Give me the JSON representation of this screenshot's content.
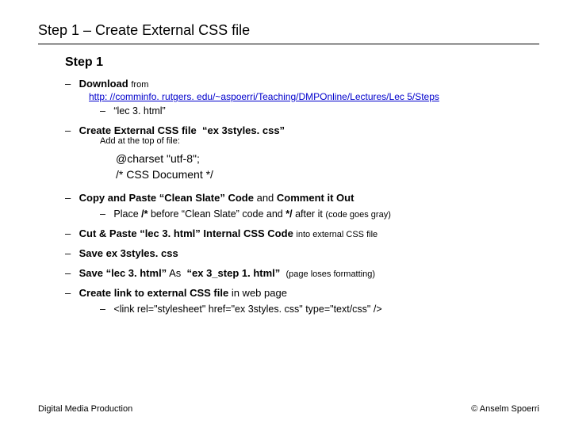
{
  "title": "Step 1 – Create External CSS file",
  "subtitle": "Step 1",
  "items": {
    "download": {
      "label": "Download",
      "suffix": "from"
    },
    "url": "http: //comminfo. rutgers. edu/~aspoerri/Teaching/DMPOnline/Lectures/Lec 5/Steps",
    "lec3": "“lec 3. html”",
    "createcss": {
      "label": "Create External CSS file",
      "arg": "“ex 3styles. css”"
    },
    "addtop": "Add at the top of file:",
    "charset": "@charset \"utf-8\";",
    "cssdoc": "/* CSS Document */",
    "clean": {
      "a": "Copy and Paste “Clean Slate” Code",
      "b": "and",
      "c": "Comment it Out"
    },
    "place": {
      "a": "Place",
      "b": "/*",
      "c": "before “Clean Slate” code and",
      "d": "*/",
      "e": "after it",
      "f": "(code goes gray)"
    },
    "cut": {
      "a": "Cut & Paste “lec 3. html” Internal CSS Code",
      "b": "into external CSS file"
    },
    "savecss": "Save ex 3styles. css",
    "savehtml": {
      "a": "Save “lec 3. html”",
      "b": "As",
      "c": "“ex 3_step 1. html”",
      "d": "(page loses formatting)"
    },
    "createlink": {
      "a": "Create link to external CSS file",
      "b": "in web page"
    },
    "linktag": "<link rel=\"stylesheet\" href=\"ex 3styles. css\" type=\"text/css\" />"
  },
  "footer": {
    "left": "Digital Media Production",
    "right": "© Anselm Spoerri"
  }
}
